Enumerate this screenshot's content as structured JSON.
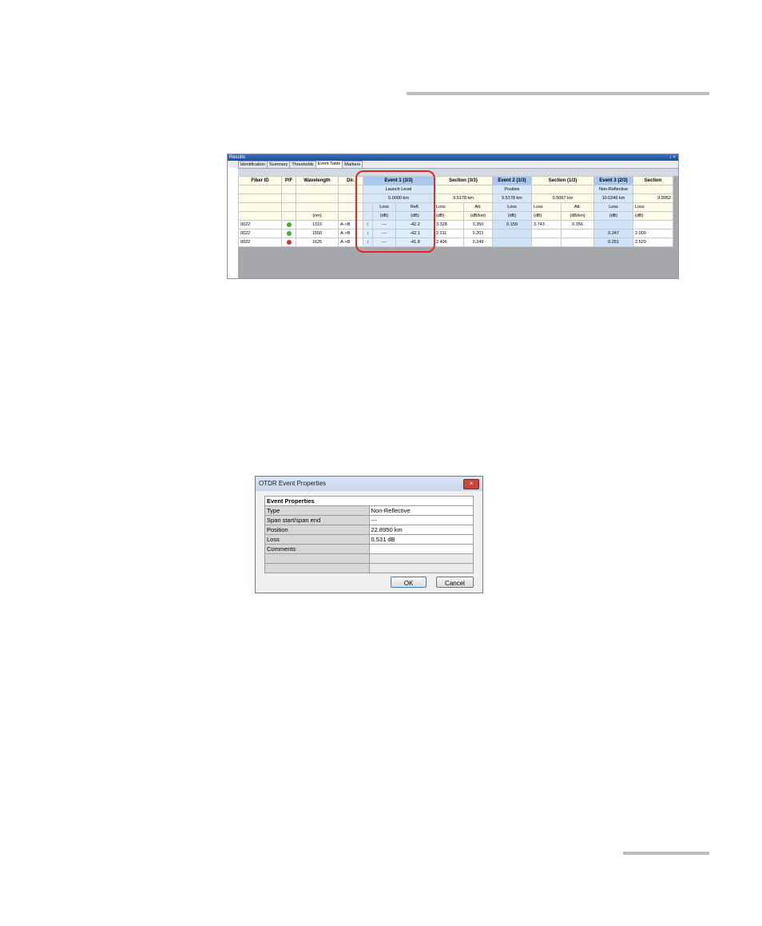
{
  "results_window": {
    "title": "Results",
    "controls": "↓ ×",
    "tabs": [
      "Identification",
      "Summary",
      "Thresholds",
      "Event Table",
      "Markers"
    ],
    "active_tab": "Event Table",
    "header": {
      "fiber_id": "Fiber ID",
      "pf": "P/F",
      "wavelength": "Wavelength",
      "dir": "Dir.",
      "event1": "Event 1 (3/3)",
      "section1": "Section (3/3)",
      "event2": "Event 2 (1/3)",
      "section2": "Section (1/3)",
      "event3": "Event 3 (2/3)",
      "section3": "Section",
      "event1_type": "Launch Level",
      "event2_type": "Positive",
      "event3_type": "Non-Reflective",
      "event1_pos": "0.0000 km",
      "section1_len": "9.5178 km",
      "event2_pos": "9.5178 km",
      "section2_len": "0.5067 km",
      "event3_pos": "10.0246 km",
      "section3_len": "9.9952",
      "loss": "Loss",
      "refl": "Refl.",
      "att": "Att.",
      "unit_nm": "(nm)",
      "unit_db": "(dB)",
      "unit_dbkm": "(dB/km)"
    },
    "rows": [
      {
        "fiber_id": "0022",
        "pf": "pass",
        "wavelength": "1310",
        "dir": "A->B",
        "e1_loss": "---",
        "e1_refl": "-42.2",
        "s1_loss": "3.328",
        "s1_att": "0.350",
        "e2_loss": "0.159",
        "s2_loss": "3.743",
        "s2_att": "0.356",
        "e3_loss": "",
        "s3_loss": ""
      },
      {
        "fiber_id": "0022",
        "pf": "pass",
        "wavelength": "1550",
        "dir": "A->B",
        "e1_loss": "---",
        "e1_refl": "-42.1",
        "s1_loss": "2.011",
        "s1_att": "0.201",
        "e2_loss": "",
        "s2_loss": "",
        "s2_att": "",
        "e3_loss": "0.247",
        "s3_loss": "2.000"
      },
      {
        "fiber_id": "0022",
        "pf": "fail",
        "wavelength": "1625",
        "dir": "A->B",
        "e1_loss": "---",
        "e1_refl": "-41.8",
        "s1_loss": "2.496",
        "s1_att": "0.249",
        "e2_loss": "",
        "s2_loss": "",
        "s2_att": "",
        "e3_loss": "0.251",
        "s3_loss": "2.520"
      }
    ]
  },
  "dialog": {
    "title": "OTDR Event Properties",
    "section_header": "Event Properties",
    "properties": [
      {
        "key": "Type",
        "value": "Non-Reflective"
      },
      {
        "key": "Span start/span end",
        "value": "---"
      },
      {
        "key": "Position",
        "value": "22.8950 km"
      },
      {
        "key": "Loss",
        "value": "0.531 dB"
      },
      {
        "key": "Comments",
        "value": ""
      },
      {
        "key": "",
        "value": ""
      },
      {
        "key": "",
        "value": ""
      }
    ],
    "ok_label": "OK",
    "cancel_label": "Cancel",
    "close_glyph": "×"
  }
}
